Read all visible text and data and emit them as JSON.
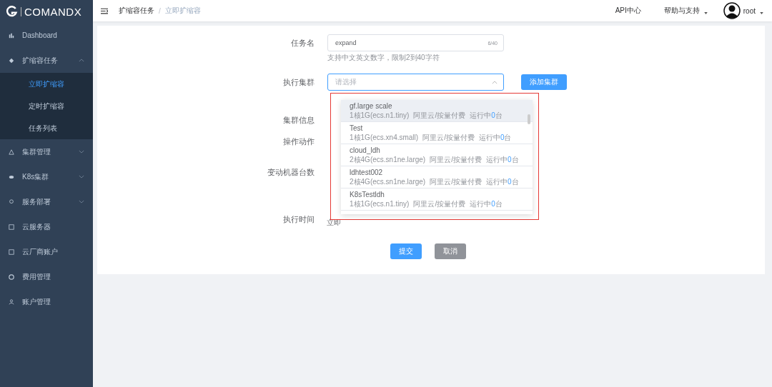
{
  "logo": {
    "text": "COMANDX"
  },
  "sidebar": {
    "items": [
      {
        "label": "Dashboard"
      },
      {
        "label": "扩缩容任务",
        "expanded": true,
        "children": [
          {
            "label": "立即扩缩容",
            "selected": true
          },
          {
            "label": "定时扩缩容",
            "selected": false
          },
          {
            "label": "任务列表",
            "selected": false
          }
        ]
      },
      {
        "label": "集群管理",
        "expanded": false
      },
      {
        "label": "K8s集群",
        "expanded": false
      },
      {
        "label": "服务部署",
        "expanded": false
      },
      {
        "label": "云服务器"
      },
      {
        "label": "云厂商账户"
      },
      {
        "label": "费用管理"
      },
      {
        "label": "账户管理"
      }
    ]
  },
  "header": {
    "breadcrumb": [
      "扩缩容任务",
      "立即扩缩容"
    ],
    "separator": "/",
    "links": [
      "API中心",
      "帮助与支持"
    ],
    "user": "root"
  },
  "form": {
    "task_name": {
      "label": "任务名",
      "value": "expand",
      "counter": "6/40",
      "hint": "支持中文英文数字，限制2到40字符"
    },
    "cluster": {
      "label": "执行集群",
      "placeholder": "请选择",
      "add_button": "添加集群"
    },
    "labels": [
      "集群信息",
      "操作动作",
      "变动机器台数"
    ],
    "exec_time": {
      "label": "执行时间",
      "value": "立即"
    },
    "submit": "提交",
    "cancel": "取消"
  },
  "dropdown": {
    "options": [
      {
        "name": "gf.large scale",
        "spec": "1核1G(ecs.n1.tiny)",
        "billing": "阿里云/按量付费",
        "running_label": "运行中",
        "running_count": "0",
        "running_unit": "台",
        "selected": true
      },
      {
        "name": "Test",
        "spec": "1核1G(ecs.xn4.small)",
        "billing": "阿里云/按量付费",
        "running_label": "运行中",
        "running_count": "0",
        "running_unit": "台",
        "selected": false
      },
      {
        "name": "cloud_ldh",
        "spec": "2核4G(ecs.sn1ne.large)",
        "billing": "阿里云/按量付费",
        "running_label": "运行中",
        "running_count": "0",
        "running_unit": "台",
        "selected": false
      },
      {
        "name": "ldhtest002",
        "spec": "2核4G(ecs.sn1ne.large)",
        "billing": "阿里云/按量付费",
        "running_label": "运行中",
        "running_count": "0",
        "running_unit": "台",
        "selected": false
      },
      {
        "name": "K8sTestldh",
        "spec": "1核1G(ecs.n1.tiny)",
        "billing": "阿里云/按量付费",
        "running_label": "运行中",
        "running_count": "0",
        "running_unit": "台",
        "selected": false
      }
    ]
  }
}
